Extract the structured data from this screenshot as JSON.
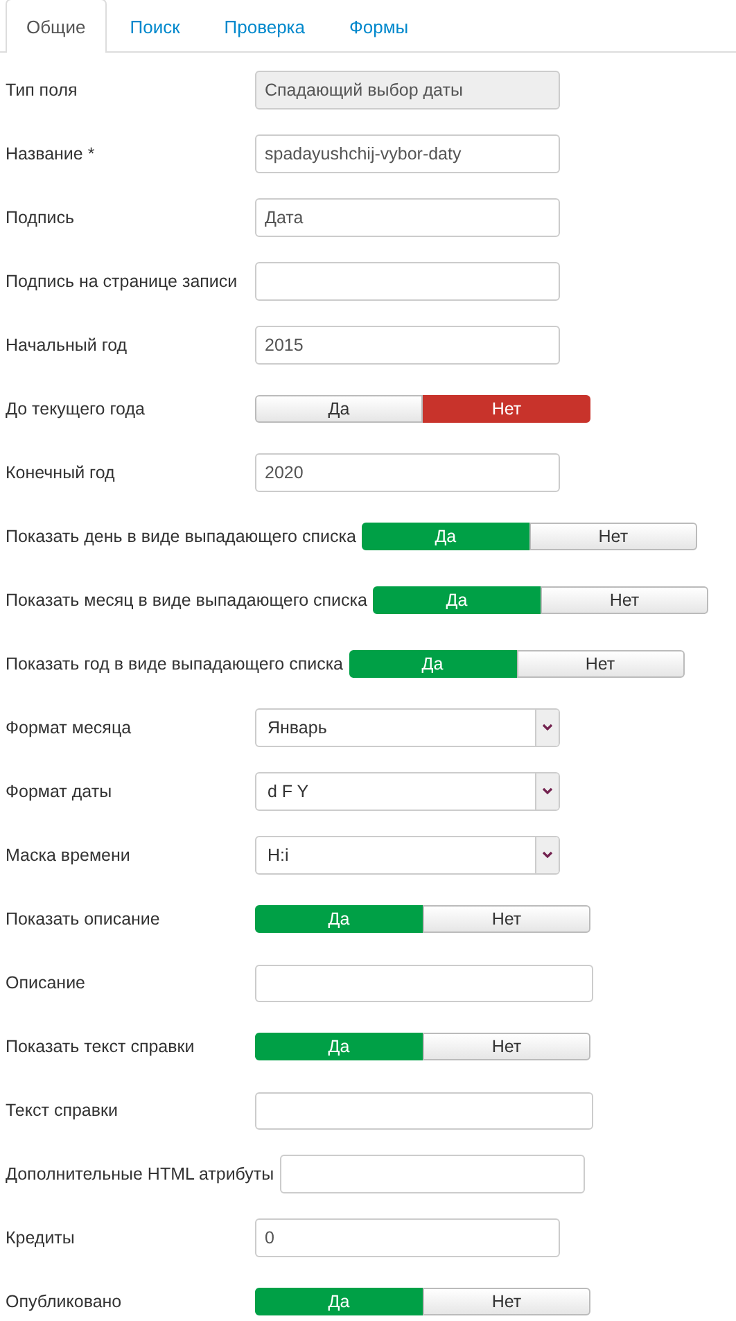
{
  "tabs": [
    {
      "label": "Общие",
      "selected": true
    },
    {
      "label": "Поиск",
      "selected": false
    },
    {
      "label": "Проверка",
      "selected": false
    },
    {
      "label": "Формы",
      "selected": false
    }
  ],
  "fields": [
    {
      "label": "Тип поля",
      "kind": "readonly",
      "value": "Спадающий выбор даты"
    },
    {
      "label": "Название *",
      "kind": "text",
      "value": "spadayushchij-vybor-daty"
    },
    {
      "label": "Подпись",
      "kind": "text",
      "value": "Дата"
    },
    {
      "label": "Подпись на странице записи",
      "kind": "text"
    },
    {
      "label": "Начальный год",
      "kind": "text",
      "value": "2015"
    },
    {
      "label": "До текущего года",
      "kind": "toggle",
      "options": [
        {
          "label": "Да",
          "selected": false
        },
        {
          "label": "Нет",
          "selected": true
        }
      ]
    },
    {
      "label": "Конечный год",
      "kind": "text",
      "value": "2020"
    },
    {
      "label": "Показать день в виде выпадающего списка",
      "kind": "toggle",
      "options": [
        {
          "label": "Да",
          "selected": true
        },
        {
          "label": "Нет",
          "selected": false
        }
      ]
    },
    {
      "label": "Показать месяц в виде выпадающего списка",
      "kind": "toggle",
      "options": [
        {
          "label": "Да",
          "selected": true
        },
        {
          "label": "Нет",
          "selected": false
        }
      ]
    },
    {
      "label": "Показать год в виде выпадающего списка",
      "kind": "toggle",
      "options": [
        {
          "label": "Да",
          "selected": true
        },
        {
          "label": "Нет",
          "selected": false
        }
      ]
    },
    {
      "label": "Формат месяца",
      "kind": "select",
      "value": "Январь"
    },
    {
      "label": "Формат даты",
      "kind": "select",
      "value": "d F Y"
    },
    {
      "label": "Маска времени",
      "kind": "select",
      "value": "H:i"
    },
    {
      "label": "Показать описание",
      "kind": "toggle",
      "options": [
        {
          "label": "Да",
          "selected": true
        },
        {
          "label": "Нет",
          "selected": false
        }
      ]
    },
    {
      "label": "Описание",
      "kind": "textarea"
    },
    {
      "label": "Показать текст справки",
      "kind": "toggle",
      "options": [
        {
          "label": "Да",
          "selected": true
        },
        {
          "label": "Нет",
          "selected": false
        }
      ]
    },
    {
      "label": "Текст справки",
      "kind": "textarea"
    },
    {
      "label": "Дополнительные HTML атрибуты",
      "kind": "text"
    },
    {
      "label": "Кредиты",
      "kind": "text",
      "value": "0"
    },
    {
      "label": "Опубликовано",
      "kind": "toggle",
      "options": [
        {
          "label": "Да",
          "selected": true
        },
        {
          "label": "Нет",
          "selected": false
        }
      ]
    }
  ]
}
